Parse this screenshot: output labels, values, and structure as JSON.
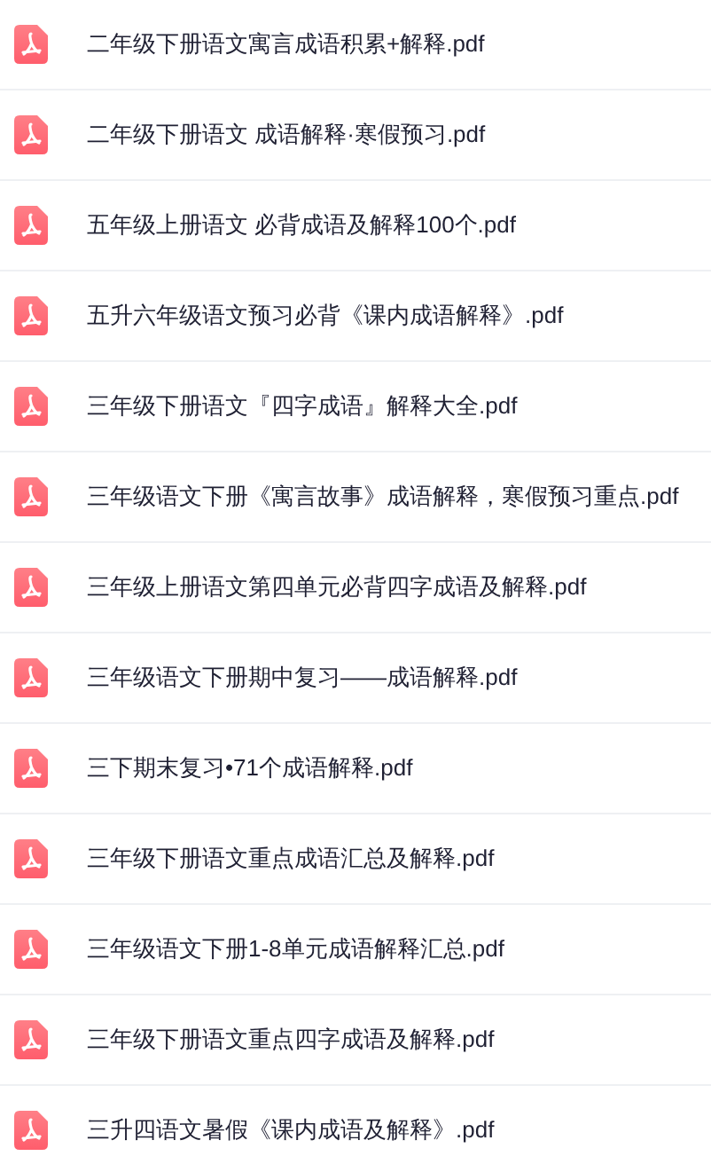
{
  "files": [
    {
      "name": "二年级下册语文寓言成语积累+解释.pdf"
    },
    {
      "name": "二年级下册语文 成语解释·寒假预习.pdf"
    },
    {
      "name": "五年级上册语文 必背成语及解释100个.pdf"
    },
    {
      "name": "五升六年级语文预习必背《课内成语解释》.pdf"
    },
    {
      "name": "三年级下册语文『四字成语』解释大全.pdf"
    },
    {
      "name": "三年级语文下册《寓言故事》成语解释，寒假预习重点.pdf"
    },
    {
      "name": "三年级上册语文第四单元必背四字成语及解释.pdf"
    },
    {
      "name": "三年级语文下册期中复习——成语解释.pdf"
    },
    {
      "name": "三下期末复习•71个成语解释.pdf"
    },
    {
      "name": "三年级下册语文重点成语汇总及解释.pdf"
    },
    {
      "name": "三年级语文下册1-8单元成语解释汇总.pdf"
    },
    {
      "name": "三年级下册语文重点四字成语及解释.pdf"
    },
    {
      "name": "三升四语文暑假《课内成语及解释》.pdf"
    }
  ]
}
